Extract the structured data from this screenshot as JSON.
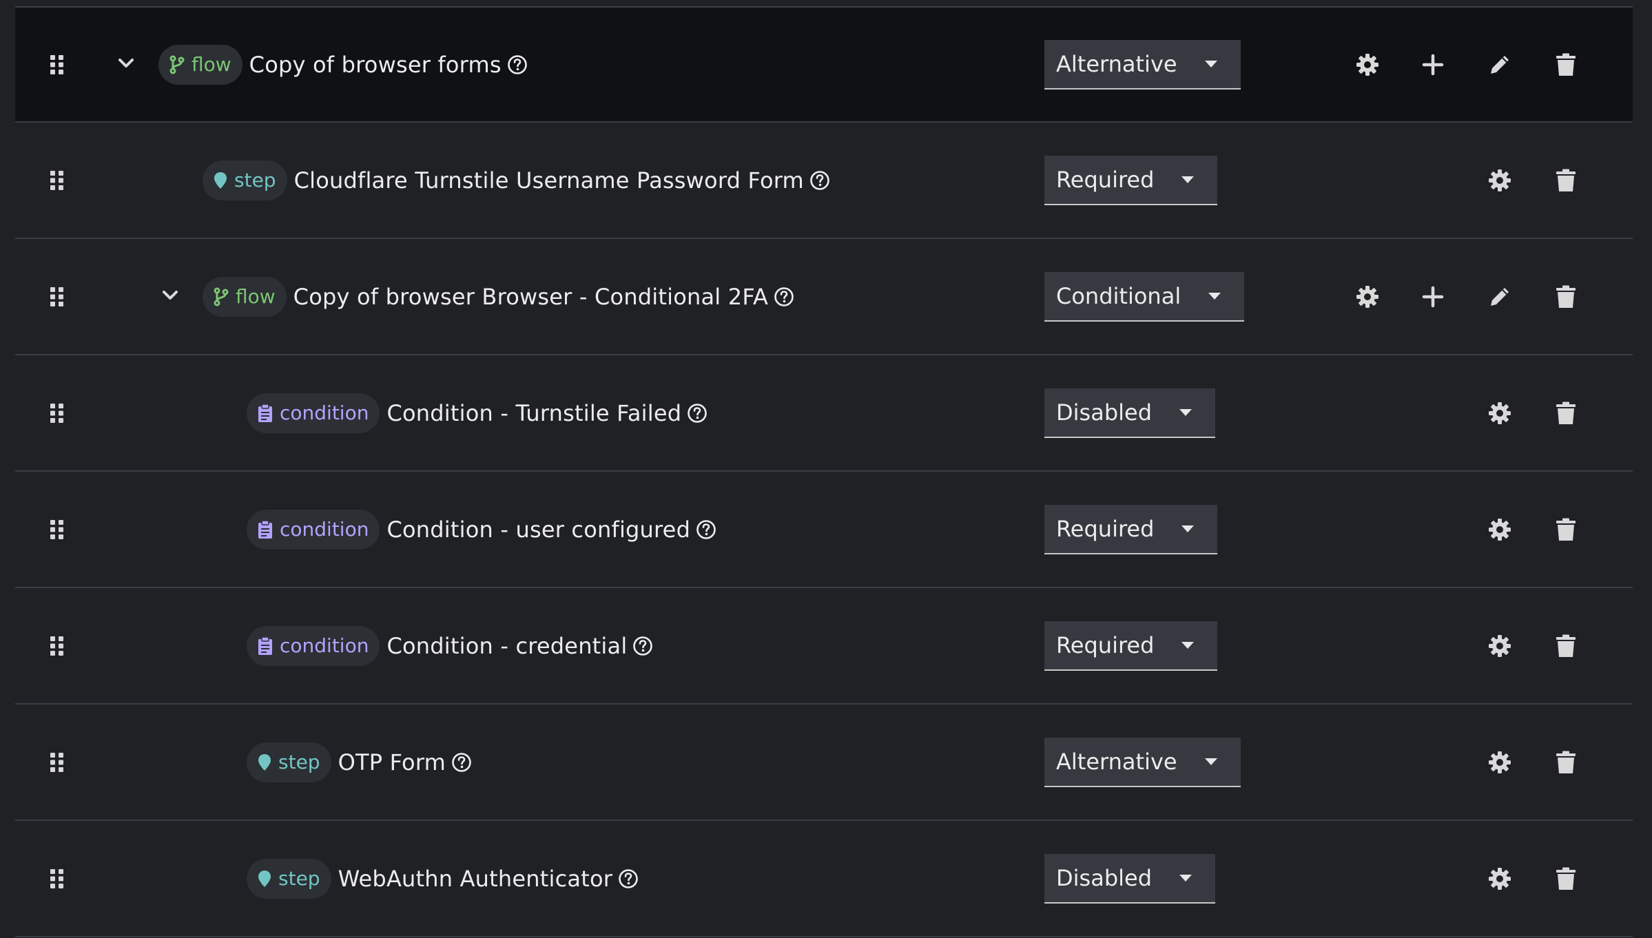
{
  "colors": {
    "flow_badge": "#7cc674",
    "step_badge": "#73c5c5",
    "condition_badge": "#b2a3ff",
    "selected_row_bg": "#0f1114"
  },
  "rows": [
    {
      "type_label": "flow",
      "type_icon": "flow-branch-icon",
      "name": "Copy of browser forms",
      "requirement": "Alternative",
      "expandable": true,
      "actions": [
        "gear-icon",
        "plus-icon",
        "pencil-icon",
        "trash-icon"
      ],
      "selected": true
    },
    {
      "type_label": "step",
      "type_icon": "map-pin-icon",
      "name": "Cloudflare Turnstile Username Password Form",
      "requirement": "Required",
      "expandable": false,
      "actions": [
        "gear-icon",
        "trash-icon"
      ]
    },
    {
      "type_label": "flow",
      "type_icon": "flow-branch-icon",
      "name": "Copy of browser Browser - Conditional 2FA",
      "requirement": "Conditional",
      "expandable": true,
      "actions": [
        "gear-icon",
        "plus-icon",
        "pencil-icon",
        "trash-icon"
      ]
    },
    {
      "type_label": "condition",
      "type_icon": "clipboard-icon",
      "name": "Condition - Turnstile Failed",
      "requirement": "Disabled",
      "expandable": false,
      "actions": [
        "gear-icon",
        "trash-icon"
      ]
    },
    {
      "type_label": "condition",
      "type_icon": "clipboard-icon",
      "name": "Condition - user configured",
      "requirement": "Required",
      "expandable": false,
      "actions": [
        "gear-icon",
        "trash-icon"
      ]
    },
    {
      "type_label": "condition",
      "type_icon": "clipboard-icon",
      "name": "Condition - credential",
      "requirement": "Required",
      "expandable": false,
      "actions": [
        "gear-icon",
        "trash-icon"
      ]
    },
    {
      "type_label": "step",
      "type_icon": "map-pin-icon",
      "name": "OTP Form",
      "requirement": "Alternative",
      "expandable": false,
      "actions": [
        "gear-icon",
        "trash-icon"
      ]
    },
    {
      "type_label": "step",
      "type_icon": "map-pin-icon",
      "name": "WebAuthn Authenticator",
      "requirement": "Disabled",
      "expandable": false,
      "actions": [
        "gear-icon",
        "trash-icon"
      ]
    }
  ]
}
